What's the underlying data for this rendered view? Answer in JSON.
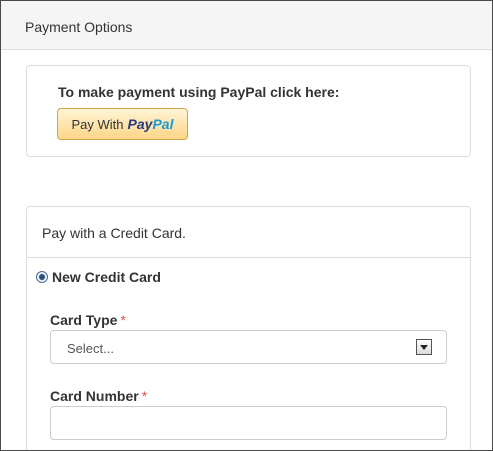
{
  "panel": {
    "title": "Payment Options"
  },
  "paypal": {
    "prompt": "To make payment using PayPal click here:",
    "button_prefix": "Pay With",
    "logo_part1": "Pay",
    "logo_part2": "Pal"
  },
  "credit_card": {
    "heading": "Pay with a Credit Card.",
    "option_label": "New Credit Card",
    "option_selected": true,
    "card_type": {
      "label": "Card Type",
      "required_mark": "*",
      "selected_value": "Select..."
    },
    "card_number": {
      "label": "Card Number",
      "required_mark": "*",
      "value": ""
    }
  },
  "colors": {
    "required": "#d9534f",
    "paypal_dark": "#253b80",
    "paypal_light": "#179bd7",
    "button_gradient_top": "#fff4d6",
    "button_gradient_bottom": "#fdd687"
  },
  "icons": {
    "select_arrow": "chevron-down-icon",
    "radio": "radio-selected-icon"
  }
}
